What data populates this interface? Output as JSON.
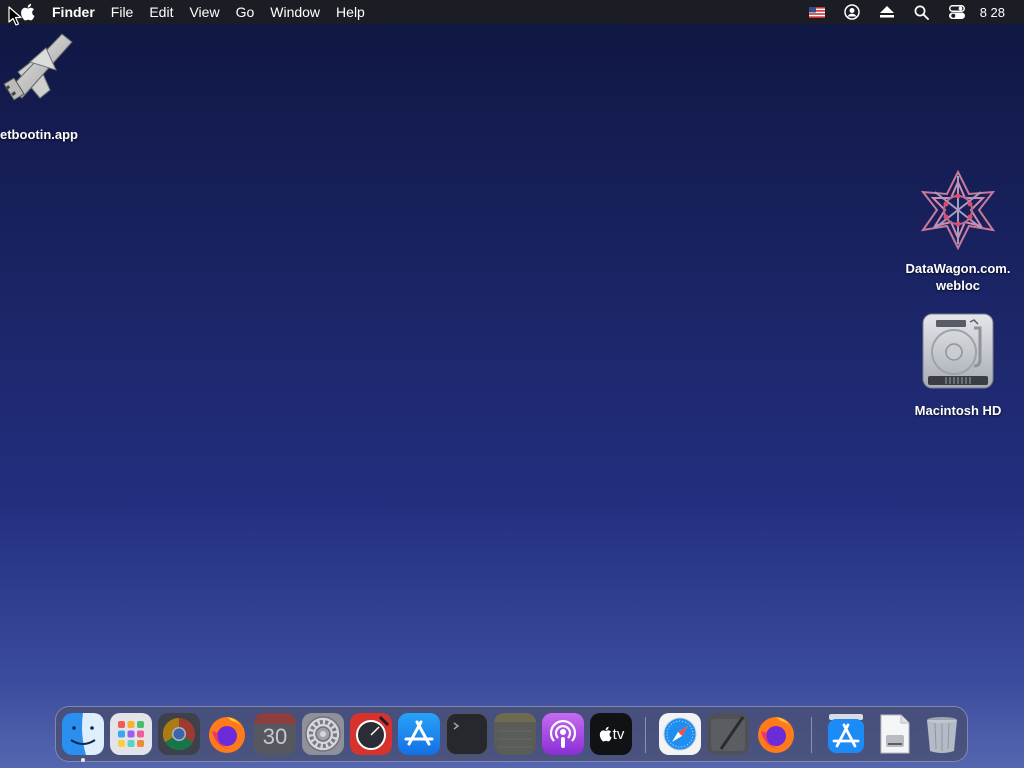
{
  "menubar": {
    "app_name": "Finder",
    "items": [
      "File",
      "Edit",
      "View",
      "Go",
      "Window",
      "Help"
    ],
    "status_icons": [
      "us-flag-input-icon",
      "user-account-icon",
      "eject-icon",
      "spotlight-search-icon",
      "control-center-icon"
    ],
    "clock": "8 28"
  },
  "desktop": {
    "icons": [
      {
        "name": "unetbootin-app",
        "label": "etbootin.app"
      },
      {
        "name": "datawagon-webloc",
        "label_line1": "DataWagon.com.",
        "label_line2": "webloc"
      },
      {
        "name": "macintosh-hd",
        "label": "Macintosh HD"
      }
    ]
  },
  "dock": {
    "apps": [
      "Finder",
      "Launchpad",
      "Google Chrome",
      "Firefox",
      "Calendar",
      "System Preferences",
      "Safari Technology Preview",
      "App Store",
      "Terminal",
      "Notes",
      "Podcasts",
      "TV",
      "Safari",
      "Script Editor",
      "Firefox",
      "App Store",
      "Disk Image",
      "Trash"
    ],
    "calendar_day": "30",
    "tv_label": "tv"
  },
  "colors": {
    "menubar_bg": "#1b1d24",
    "wallpaper_top": "#0f1640",
    "wallpaper_bottom": "#5566b0"
  }
}
